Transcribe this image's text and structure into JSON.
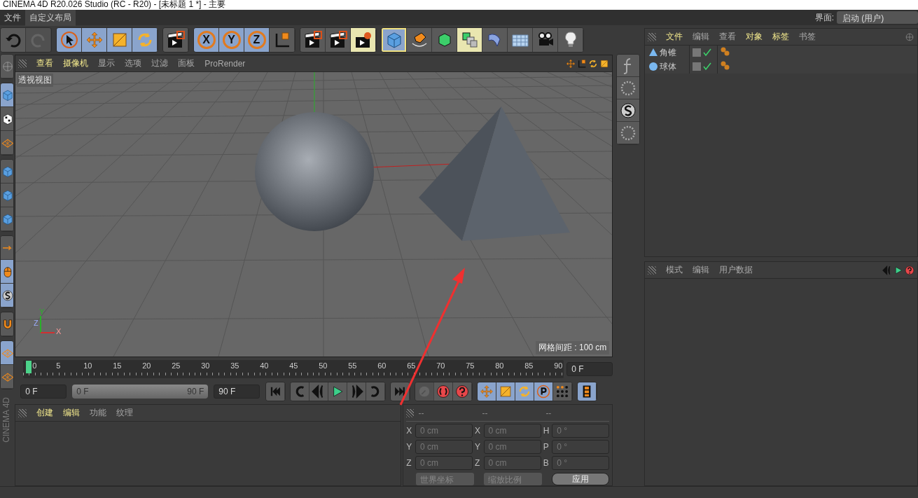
{
  "window": {
    "title": "CINEMA 4D R20.026 Studio (RC - R20) - [未标题 1 *] - 主要"
  },
  "menu_bar": {
    "items": [
      {
        "label": "文件",
        "selected": false
      },
      {
        "label": "自定义布局",
        "selected": true
      }
    ],
    "layout_label": "界面:",
    "layout_value": "启动 (用户)"
  },
  "toolbar": {
    "groups": [
      [
        {
          "kind": "undo",
          "selected": false,
          "highlighted": false,
          "disabled": false
        },
        {
          "kind": "redo",
          "selected": false,
          "highlighted": false,
          "disabled": true
        }
      ],
      [
        {
          "kind": "select",
          "selected": true,
          "highlighted": false,
          "disabled": false
        },
        {
          "kind": "move",
          "selected": true,
          "highlighted": false,
          "disabled": false
        },
        {
          "kind": "scale",
          "selected": true,
          "highlighted": false,
          "disabled": false
        },
        {
          "kind": "rotate",
          "selected": true,
          "highlighted": false,
          "disabled": false
        }
      ],
      [
        {
          "kind": "clapper",
          "selected": false,
          "highlighted": false,
          "disabled": false
        }
      ],
      [
        {
          "kind": "letter",
          "label": "X",
          "selected": true,
          "highlighted": false,
          "disabled": false
        },
        {
          "kind": "letter",
          "label": "Y",
          "selected": true,
          "highlighted": false,
          "disabled": false
        },
        {
          "kind": "letter",
          "label": "Z",
          "selected": true,
          "highlighted": false,
          "disabled": false
        },
        {
          "kind": "axes",
          "selected": false,
          "highlighted": false,
          "disabled": false
        }
      ],
      [
        {
          "kind": "clapper",
          "selected": false,
          "highlighted": false,
          "disabled": false
        },
        {
          "kind": "clapper",
          "selected": false,
          "highlighted": false,
          "disabled": false
        },
        {
          "kind": "gear-clapper",
          "selected": false,
          "highlighted": true,
          "disabled": false
        }
      ],
      [
        {
          "kind": "cube",
          "selected": true,
          "highlighted": true,
          "disabled": false
        },
        {
          "kind": "pen",
          "selected": false,
          "highlighted": false,
          "disabled": false
        },
        {
          "kind": "green-cube",
          "selected": false,
          "highlighted": false,
          "disabled": false
        },
        {
          "kind": "stack",
          "selected": false,
          "highlighted": true,
          "disabled": false
        },
        {
          "kind": "bend",
          "selected": false,
          "highlighted": false,
          "disabled": false
        },
        {
          "kind": "plane",
          "selected": false,
          "highlighted": false,
          "disabled": false
        },
        {
          "kind": "camera",
          "selected": false,
          "highlighted": false,
          "disabled": false
        },
        {
          "kind": "bulb",
          "selected": false,
          "highlighted": false,
          "disabled": false
        }
      ]
    ]
  },
  "left_toolbar": {
    "groups": [
      [
        {
          "kind": "globe",
          "selected": false,
          "highlighted": false,
          "disabled": false
        }
      ],
      [
        {
          "kind": "cube",
          "selected": true,
          "highlighted": false,
          "disabled": false
        },
        {
          "kind": "checker",
          "selected": false,
          "highlighted": false,
          "disabled": false
        },
        {
          "kind": "mesh",
          "selected": false,
          "highlighted": false,
          "disabled": false
        }
      ],
      [
        {
          "kind": "cube",
          "selected": false,
          "highlighted": false,
          "disabled": false
        },
        {
          "kind": "cube",
          "selected": false,
          "highlighted": false,
          "disabled": false
        },
        {
          "kind": "cube",
          "selected": false,
          "highlighted": false,
          "disabled": false
        }
      ],
      [
        {
          "kind": "arrow",
          "selected": false,
          "highlighted": false,
          "disabled": false
        },
        {
          "kind": "mouse",
          "selected": true,
          "highlighted": false,
          "disabled": false
        },
        {
          "kind": "s",
          "selected": true,
          "highlighted": false,
          "disabled": false
        }
      ],
      [
        {
          "kind": "magnet",
          "selected": false,
          "highlighted": false,
          "disabled": false
        }
      ],
      [
        {
          "kind": "mesh",
          "selected": true,
          "highlighted": false,
          "disabled": false
        },
        {
          "kind": "mesh",
          "selected": false,
          "highlighted": false,
          "disabled": false
        }
      ]
    ],
    "brand": "CINEMA 4D"
  },
  "viewport": {
    "menu": [
      {
        "label": "查看",
        "highlighted": true
      },
      {
        "label": "摄像机",
        "highlighted": true
      },
      {
        "label": "显示",
        "highlighted": false
      },
      {
        "label": "选项",
        "highlighted": false
      },
      {
        "label": "过滤",
        "highlighted": false
      },
      {
        "label": "面板",
        "highlighted": false
      },
      {
        "label": "ProRender",
        "highlighted": false
      }
    ],
    "view_label": "透视视图",
    "grid_spacing": "网格间距 : 100 cm",
    "axis_labels": [
      "Y",
      "Z",
      "X"
    ]
  },
  "side_toolbar": {
    "tools": [
      {
        "kind": "fx"
      },
      {
        "kind": "dots"
      },
      {
        "kind": "s"
      },
      {
        "kind": "dots"
      }
    ]
  },
  "timeline": {
    "ticks": [
      "0",
      "5",
      "10",
      "15",
      "20",
      "25",
      "30",
      "35",
      "40",
      "45",
      "50",
      "55",
      "60",
      "65",
      "70",
      "75",
      "80",
      "85",
      "90"
    ],
    "level": 0,
    "current": "0 F"
  },
  "playback": {
    "start": "0 F",
    "range": {
      "start": "0 F",
      "end": "90 F",
      "level": 1
    },
    "end": "90 F",
    "groups": [
      [
        {
          "kind": "to-start",
          "selected": false,
          "highlighted": false,
          "disabled": false
        }
      ],
      [
        {
          "kind": "prev-key",
          "selected": false,
          "highlighted": false,
          "disabled": false
        },
        {
          "kind": "prev-frame",
          "selected": false,
          "highlighted": false,
          "disabled": false
        },
        {
          "kind": "play",
          "selected": false,
          "highlighted": false,
          "disabled": false
        },
        {
          "kind": "next-frame",
          "selected": false,
          "highlighted": false,
          "disabled": false
        },
        {
          "kind": "next-key",
          "selected": false,
          "highlighted": false,
          "disabled": false
        }
      ],
      [
        {
          "kind": "to-end",
          "selected": false,
          "highlighted": false,
          "disabled": false
        }
      ],
      [
        {
          "kind": "key",
          "selected": false,
          "highlighted": false,
          "disabled": true
        },
        {
          "kind": "record",
          "selected": false,
          "highlighted": false,
          "disabled": false
        },
        {
          "kind": "help",
          "selected": false,
          "highlighted": false,
          "disabled": false
        }
      ],
      [
        {
          "kind": "move",
          "selected": true,
          "highlighted": false,
          "disabled": false
        },
        {
          "kind": "scale",
          "selected": true,
          "highlighted": false,
          "disabled": false
        },
        {
          "kind": "rotate",
          "selected": true,
          "highlighted": false,
          "disabled": false
        },
        {
          "kind": "param",
          "selected": true,
          "highlighted": false,
          "disabled": false
        },
        {
          "kind": "points",
          "selected": false,
          "highlighted": false,
          "disabled": false
        }
      ],
      [
        {
          "kind": "film",
          "selected": true,
          "highlighted": false,
          "disabled": false
        }
      ]
    ]
  },
  "material_manager": {
    "menu": [
      {
        "label": "创建",
        "highlighted": true
      },
      {
        "label": "编辑",
        "highlighted": true
      },
      {
        "label": "功能",
        "highlighted": false
      },
      {
        "label": "纹理",
        "highlighted": false
      }
    ]
  },
  "coordinates": {
    "headers": [
      "--",
      "--",
      "--"
    ],
    "disabled": true,
    "rows": [
      [
        {
          "axis": "X",
          "value": "0 cm"
        },
        {
          "axis": "X",
          "value": "0 cm"
        },
        {
          "axis": "H",
          "value": "0 °"
        }
      ],
      [
        {
          "axis": "Y",
          "value": "0 cm"
        },
        {
          "axis": "Y",
          "value": "0 cm"
        },
        {
          "axis": "P",
          "value": "0 °"
        }
      ],
      [
        {
          "axis": "Z",
          "value": "0 cm"
        },
        {
          "axis": "Z",
          "value": "0 cm"
        },
        {
          "axis": "B",
          "value": "0 °"
        }
      ]
    ],
    "dropdowns": [
      "世界坐标",
      "缩放比例"
    ],
    "apply": "应用"
  },
  "object_manager": {
    "menu": [
      {
        "label": "文件",
        "highlighted": true
      },
      {
        "label": "编辑",
        "highlighted": false
      },
      {
        "label": "查看",
        "highlighted": false
      },
      {
        "label": "对象",
        "highlighted": true
      },
      {
        "label": "标签",
        "highlighted": true
      },
      {
        "label": "书签",
        "highlighted": false
      }
    ],
    "objects": [
      {
        "name": "角锥",
        "kind": "cone",
        "enabled": true
      },
      {
        "name": "球体",
        "kind": "sphere",
        "enabled": true
      }
    ]
  },
  "attribute_manager": {
    "menu": [
      {
        "label": "模式",
        "highlighted": false
      },
      {
        "label": "编辑",
        "highlighted": false
      },
      {
        "label": "用户数据",
        "highlighted": false
      }
    ]
  }
}
